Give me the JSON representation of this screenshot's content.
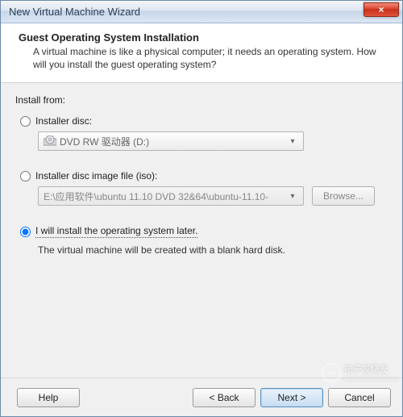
{
  "window": {
    "title": "New Virtual Machine Wizard",
    "close_glyph": "×"
  },
  "header": {
    "title": "Guest Operating System Installation",
    "description": "A virtual machine is like a physical computer; it needs an operating system. How will you install the guest operating system?"
  },
  "body": {
    "install_from_label": "Install from:",
    "option_disc": {
      "label": "Installer disc:",
      "value": "DVD RW 驱动器 (D:)",
      "arrow": "▾"
    },
    "option_iso": {
      "label": "Installer disc image file (iso):",
      "value": "E:\\应用软件\\ubuntu 11.10 DVD 32&64\\ubuntu-11.10-",
      "arrow": "▾",
      "browse_label": "Browse..."
    },
    "option_later": {
      "label": "I will install the operating system later.",
      "description": "The virtual machine will be created with a blank hard disk."
    }
  },
  "footer": {
    "help": "Help",
    "back": "< Back",
    "next": "Next >",
    "cancel": "Cancel"
  },
  "watermark": {
    "text": "电子发烧友",
    "sub": "www.elecfans.com"
  }
}
